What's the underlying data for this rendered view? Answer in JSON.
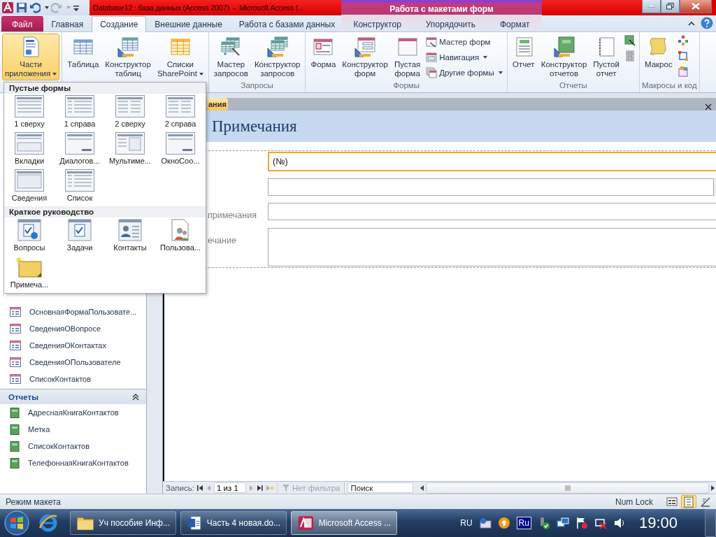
{
  "title_bar": {
    "title": "Database12 : база данных (Access 2007)  -  Microsoft Access (...",
    "context_label": "Работа с макетами форм"
  },
  "tabs": [
    {
      "label": "Файл",
      "kind": "file",
      "selected": false
    },
    {
      "label": "Главная",
      "kind": "tab",
      "selected": false
    },
    {
      "label": "Создание",
      "kind": "tab",
      "selected": true
    },
    {
      "label": "Внешние данные",
      "kind": "tab",
      "selected": false
    },
    {
      "label": "Работа с базами данных",
      "kind": "tab",
      "selected": false
    },
    {
      "label": "Конструктор",
      "kind": "context",
      "selected": false
    },
    {
      "label": "Упорядочить",
      "kind": "context",
      "selected": false
    },
    {
      "label": "Формат",
      "kind": "context",
      "selected": false
    }
  ],
  "ribbon": {
    "groups": [
      {
        "buttons": [
          {
            "kind": "large",
            "label": "Части\nприложения",
            "dropdown": true,
            "pressed": true
          }
        ]
      },
      {
        "buttons": [
          {
            "kind": "large",
            "label": "Таблица",
            "dropdown": false,
            "pressed": false
          },
          {
            "kind": "large",
            "label": "Конструктор\nтаблиц",
            "dropdown": false,
            "pressed": false
          },
          {
            "kind": "large",
            "label": "Списки\nSharePoint",
            "dropdown": true,
            "pressed": false
          }
        ]
      },
      {
        "label": "Запросы",
        "buttons": [
          {
            "kind": "large",
            "label": "Мастер\nзапросов",
            "dropdown": false,
            "pressed": false
          },
          {
            "kind": "large",
            "label": "Конструктор\nзапросов",
            "dropdown": false,
            "pressed": false
          }
        ]
      },
      {
        "label": "Формы",
        "buttons": [
          {
            "kind": "large",
            "label": "Форма",
            "dropdown": false,
            "pressed": false
          },
          {
            "kind": "large",
            "label": "Конструктор\nформ",
            "dropdown": false,
            "pressed": false
          },
          {
            "kind": "large",
            "label": "Пустая\nформа",
            "dropdown": false,
            "pressed": false
          },
          {
            "kind": "stack",
            "items": [
              {
                "label": "Мастер форм",
                "dropdown": false
              },
              {
                "label": "Навигация",
                "dropdown": true
              },
              {
                "label": "Другие формы",
                "dropdown": true
              }
            ]
          }
        ]
      },
      {
        "label": "Отчеты",
        "buttons": [
          {
            "kind": "large",
            "label": "Отчет",
            "dropdown": false,
            "pressed": false
          },
          {
            "kind": "large",
            "label": "Конструктор\nотчетов",
            "dropdown": false,
            "pressed": false
          },
          {
            "kind": "large",
            "label": "Пустой\nотчет",
            "dropdown": false,
            "pressed": false
          },
          {
            "kind": "icons"
          }
        ]
      },
      {
        "label": "Макросы и код",
        "buttons": [
          {
            "kind": "large",
            "label": "Макрос",
            "dropdown": false,
            "pressed": false
          },
          {
            "kind": "icons"
          }
        ]
      }
    ]
  },
  "gallery": {
    "sections": [
      {
        "title": "Пустые формы",
        "items": [
          {
            "label": "1 сверху"
          },
          {
            "label": "1 справа"
          },
          {
            "label": "2 сверху"
          },
          {
            "label": "2 справа"
          },
          {
            "label": "Вкладки"
          },
          {
            "label": "Диалогов..."
          },
          {
            "label": "Мультиме..."
          },
          {
            "label": "ОкноСоо..."
          },
          {
            "label": "Сведения"
          },
          {
            "label": "Список"
          }
        ]
      },
      {
        "title": "Краткое руководство",
        "items": [
          {
            "label": "Вопросы"
          },
          {
            "label": "Задачи"
          },
          {
            "label": "Контакты"
          },
          {
            "label": "Пользова..."
          },
          {
            "label": "Примеча..."
          }
        ]
      }
    ]
  },
  "nav_pane": {
    "groups": [
      {
        "kind": "forms",
        "items": [
          "ОсновнаяФормаПользовате...",
          "СведенияОВопросе",
          "СведенияОКонтактах",
          "СведенияОПользователе",
          "СписокКонтактов"
        ]
      },
      {
        "kind": "reports",
        "title": "Отчеты",
        "expanded": true,
        "items": [
          "АдреснаяКнигаКонтактов",
          "Метка",
          "СписокКонтактов",
          "ТелефоннаяКнигаКонтактов"
        ]
      }
    ]
  },
  "document": {
    "tab": "ания",
    "title": "Примечания",
    "fields": [
      {
        "kind": "text",
        "value": "(№)",
        "focused": true
      },
      {
        "kind": "combo",
        "focused": false
      },
      {
        "kind": "text",
        "label": "примечания",
        "focused": false
      },
      {
        "kind": "memo",
        "label": "ечание",
        "focused": false
      }
    ]
  },
  "record_nav": {
    "label": "Запись:",
    "position": "1 из 1",
    "filter": {
      "label": "Нет фильтра",
      "disabled": true
    },
    "search": {
      "placeholder": "Поиск"
    }
  },
  "status_bar": {
    "mode": "Режим макета",
    "indicator": "Num Lock",
    "views": [
      {
        "selected": false
      },
      {
        "selected": true
      },
      {
        "selected": false
      }
    ]
  },
  "taskbar": {
    "buttons": [
      {
        "label": "Уч пособие Инф...",
        "selected": false
      },
      {
        "label": "Часть 4 новая.do...",
        "selected": false
      },
      {
        "label": "Microsoft Access ...",
        "selected": true
      }
    ],
    "language": "RU",
    "tray_label": "Ru",
    "clock": "19:00"
  }
}
